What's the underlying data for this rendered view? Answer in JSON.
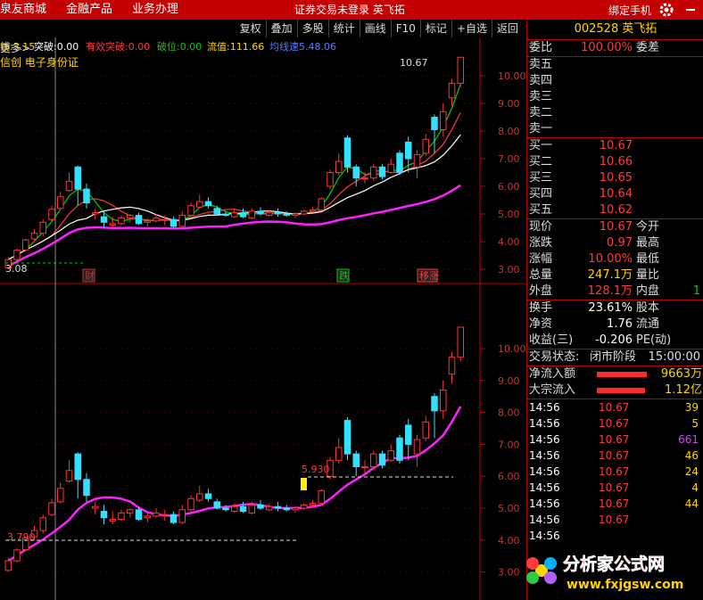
{
  "topbar": {
    "links": [
      "泉友商城",
      "金融产品",
      "业务办理"
    ],
    "center": "证券交易未登录    英飞拓",
    "right": [
      "绑定手机"
    ]
  },
  "toolbar": {
    "more": "更多>",
    "tools": [
      "复权",
      "叠加",
      "多股",
      "统计",
      "画线",
      "F10",
      "标记",
      "+自选",
      "返回"
    ]
  },
  "indicator": {
    "line1": [
      {
        "k": "线:",
        "v": "3.15",
        "c": "#ffd400"
      },
      {
        "k": "突破:",
        "v": "0.00",
        "c": "#fff"
      },
      {
        "k": "有效突破:",
        "v": "0.00",
        "c": "#ff3b3b"
      },
      {
        "k": "破位:",
        "v": "0.00",
        "c": "#00d000"
      },
      {
        "k": "流值:",
        "v": "111.66",
        "c": "#ffd400"
      },
      {
        "k": "均线速",
        "v": "5.48.06",
        "c": "#5a7bff"
      }
    ],
    "line2": "信创 电子身份证"
  },
  "price_labels": {
    "upper_high": "10.67",
    "upper_low": "3.08",
    "lower_mark": "5.930",
    "lower_low": "3.790"
  },
  "markers": {
    "cai": "财",
    "die": "跌",
    "yizhang": "移涨"
  },
  "axis_upper": [
    "10.00",
    "9.00",
    "8.00",
    "7.00",
    "6.00",
    "5.00",
    "4.00",
    "3.00"
  ],
  "axis_lower": [
    "10.00",
    "9.00",
    "8.00",
    "7.00",
    "6.00",
    "5.00",
    "4.00",
    "3.00"
  ],
  "stock": {
    "code": "002528",
    "name": "英飞拓"
  },
  "weibi": {
    "label": "委比",
    "value": "100.00%",
    "label2": "委差",
    "value2": ""
  },
  "sells": [
    {
      "label": "卖五",
      "p": "",
      "v": ""
    },
    {
      "label": "卖四",
      "p": "",
      "v": ""
    },
    {
      "label": "卖三",
      "p": "",
      "v": ""
    },
    {
      "label": "卖二",
      "p": "",
      "v": ""
    },
    {
      "label": "卖一",
      "p": "",
      "v": ""
    }
  ],
  "buys": [
    {
      "label": "买一",
      "p": "10.67",
      "v": ""
    },
    {
      "label": "买二",
      "p": "10.66",
      "v": ""
    },
    {
      "label": "买三",
      "p": "10.65",
      "v": ""
    },
    {
      "label": "买四",
      "p": "10.64",
      "v": ""
    },
    {
      "label": "买五",
      "p": "10.62",
      "v": ""
    }
  ],
  "quote": [
    {
      "l": "现价",
      "v": "10.67",
      "c": "red",
      "l2": "今开",
      "v2": ""
    },
    {
      "l": "涨跌",
      "v": "0.97",
      "c": "red",
      "l2": "最高",
      "v2": ""
    },
    {
      "l": "涨幅",
      "v": "10.00%",
      "c": "red",
      "l2": "最低",
      "v2": ""
    },
    {
      "l": "总量",
      "v": "247.1万",
      "c": "yellow",
      "l2": "量比",
      "v2": ""
    },
    {
      "l": "外盘",
      "v": "128.1万",
      "c": "red",
      "l2": "内盘",
      "v2": "1"
    }
  ],
  "quote2": [
    {
      "l": "换手",
      "v": "23.61%",
      "c": "white",
      "l2": "股本",
      "v2": ""
    },
    {
      "l": "净资",
      "v": "1.76",
      "c": "white",
      "l2": "流通",
      "v2": ""
    },
    {
      "l": "收益(三)",
      "v": "-0.206",
      "c": "white",
      "l2": "PE(动)",
      "v2": ""
    }
  ],
  "trade_state": {
    "label": "交易状态:",
    "value": "闭市阶段",
    "time": "15:00:00"
  },
  "flows": [
    {
      "label": "净流入额",
      "value": "9663万"
    },
    {
      "label": "大宗流入",
      "value": "1.12亿"
    }
  ],
  "ticks": [
    {
      "t": "14:56",
      "p": "10.67",
      "v": "39",
      "c": "#ffd400"
    },
    {
      "t": "14:56",
      "p": "10.67",
      "v": "5",
      "c": "#ffd400"
    },
    {
      "t": "14:56",
      "p": "10.67",
      "v": "661",
      "c": "#d040ff"
    },
    {
      "t": "14:56",
      "p": "10.67",
      "v": "46",
      "c": "#ffd400"
    },
    {
      "t": "14:56",
      "p": "10.67",
      "v": "24",
      "c": "#ffd400"
    },
    {
      "t": "14:56",
      "p": "10.67",
      "v": "4",
      "c": "#ffd400"
    },
    {
      "t": "14:56",
      "p": "10.67",
      "v": "44",
      "c": "#ffd400"
    },
    {
      "t": "14:56",
      "p": "10.67",
      "v": "",
      "c": "#ffd400"
    },
    {
      "t": "14:56",
      "p": "",
      "v": "",
      "c": "#ffd400"
    }
  ],
  "watermark": {
    "brand": "分析家公式网",
    "url": "www.fxjgsw.com"
  },
  "candles": [
    {
      "o": 3.05,
      "c": 3.35,
      "h": 3.45,
      "l": 3.0
    },
    {
      "o": 3.35,
      "c": 3.69,
      "h": 3.75,
      "l": 3.3
    },
    {
      "o": 3.7,
      "c": 4.06,
      "h": 4.1,
      "l": 3.65
    },
    {
      "o": 4.1,
      "c": 4.3,
      "h": 4.45,
      "l": 4.0
    },
    {
      "o": 4.3,
      "c": 4.7,
      "h": 4.8,
      "l": 4.2
    },
    {
      "o": 4.8,
      "c": 5.17,
      "h": 5.3,
      "l": 4.75
    },
    {
      "o": 5.2,
      "c": 5.62,
      "h": 5.8,
      "l": 5.15
    },
    {
      "o": 5.85,
      "c": 6.18,
      "h": 6.5,
      "l": 5.8
    },
    {
      "o": 6.7,
      "c": 5.9,
      "h": 6.75,
      "l": 5.3
    },
    {
      "o": 5.9,
      "c": 5.4,
      "h": 6.1,
      "l": 5.2
    },
    {
      "o": 5.0,
      "c": 5.05,
      "h": 5.2,
      "l": 4.8
    },
    {
      "o": 4.9,
      "c": 4.7,
      "h": 5.1,
      "l": 4.5
    },
    {
      "o": 4.6,
      "c": 4.65,
      "h": 4.9,
      "l": 4.5
    },
    {
      "o": 4.65,
      "c": 4.85,
      "h": 4.95,
      "l": 4.6
    },
    {
      "o": 4.85,
      "c": 4.95,
      "h": 5.0,
      "l": 4.7
    },
    {
      "o": 4.95,
      "c": 4.65,
      "h": 5.05,
      "l": 4.6
    },
    {
      "o": 4.7,
      "c": 4.75,
      "h": 4.85,
      "l": 4.55
    },
    {
      "o": 4.75,
      "c": 4.85,
      "h": 5.0,
      "l": 4.7
    },
    {
      "o": 4.8,
      "c": 4.8,
      "h": 4.95,
      "l": 4.6
    },
    {
      "o": 4.8,
      "c": 4.55,
      "h": 4.9,
      "l": 4.5
    },
    {
      "o": 4.55,
      "c": 4.95,
      "h": 5.1,
      "l": 4.5
    },
    {
      "o": 4.95,
      "c": 5.3,
      "h": 5.4,
      "l": 4.9
    },
    {
      "o": 5.25,
      "c": 5.45,
      "h": 5.7,
      "l": 5.2
    },
    {
      "o": 5.45,
      "c": 5.3,
      "h": 5.6,
      "l": 5.2
    },
    {
      "o": 5.2,
      "c": 5.0,
      "h": 5.3,
      "l": 4.95
    },
    {
      "o": 5.0,
      "c": 4.95,
      "h": 5.1,
      "l": 4.9
    },
    {
      "o": 4.9,
      "c": 5.05,
      "h": 5.15,
      "l": 4.85
    },
    {
      "o": 5.05,
      "c": 4.9,
      "h": 5.2,
      "l": 4.85
    },
    {
      "o": 4.85,
      "c": 5.1,
      "h": 5.2,
      "l": 4.8
    },
    {
      "o": 5.1,
      "c": 5.0,
      "h": 5.25,
      "l": 4.95
    },
    {
      "o": 4.95,
      "c": 5.05,
      "h": 5.15,
      "l": 4.9
    },
    {
      "o": 5.05,
      "c": 5.0,
      "h": 5.2,
      "l": 4.9
    },
    {
      "o": 5.0,
      "c": 4.95,
      "h": 5.1,
      "l": 4.9
    },
    {
      "o": 4.95,
      "c": 5.0,
      "h": 5.05,
      "l": 4.85
    },
    {
      "o": 5.0,
      "c": 5.1,
      "h": 5.15,
      "l": 4.95
    },
    {
      "o": 5.1,
      "c": 5.15,
      "h": 5.25,
      "l": 5.05
    },
    {
      "o": 5.15,
      "c": 5.55,
      "h": 5.6,
      "l": 5.1
    },
    {
      "o": 6.0,
      "c": 6.5,
      "h": 6.6,
      "l": 5.9
    },
    {
      "o": 6.5,
      "c": 6.9,
      "h": 7.2,
      "l": 6.4
    },
    {
      "o": 7.75,
      "c": 6.7,
      "h": 7.85,
      "l": 6.5
    },
    {
      "o": 6.7,
      "c": 6.3,
      "h": 6.8,
      "l": 6.0
    },
    {
      "o": 6.3,
      "c": 6.3,
      "h": 6.5,
      "l": 6.1
    },
    {
      "o": 6.3,
      "c": 6.7,
      "h": 6.8,
      "l": 6.2
    },
    {
      "o": 6.7,
      "c": 6.35,
      "h": 6.8,
      "l": 6.25
    },
    {
      "o": 6.5,
      "c": 6.8,
      "h": 7.0,
      "l": 6.45
    },
    {
      "o": 7.2,
      "c": 6.5,
      "h": 7.3,
      "l": 6.4
    },
    {
      "o": 7.6,
      "c": 7.0,
      "h": 7.8,
      "l": 6.5
    },
    {
      "o": 6.7,
      "c": 7.15,
      "h": 7.3,
      "l": 6.3
    },
    {
      "o": 7.2,
      "c": 7.7,
      "h": 7.9,
      "l": 7.1
    },
    {
      "o": 8.5,
      "c": 8.05,
      "h": 8.6,
      "l": 7.2
    },
    {
      "o": 8.05,
      "c": 8.7,
      "h": 9.0,
      "l": 7.8
    },
    {
      "o": 9.2,
      "c": 9.73,
      "h": 9.9,
      "l": 8.9
    },
    {
      "o": 9.73,
      "c": 10.67,
      "h": 10.67,
      "l": 9.6
    }
  ]
}
